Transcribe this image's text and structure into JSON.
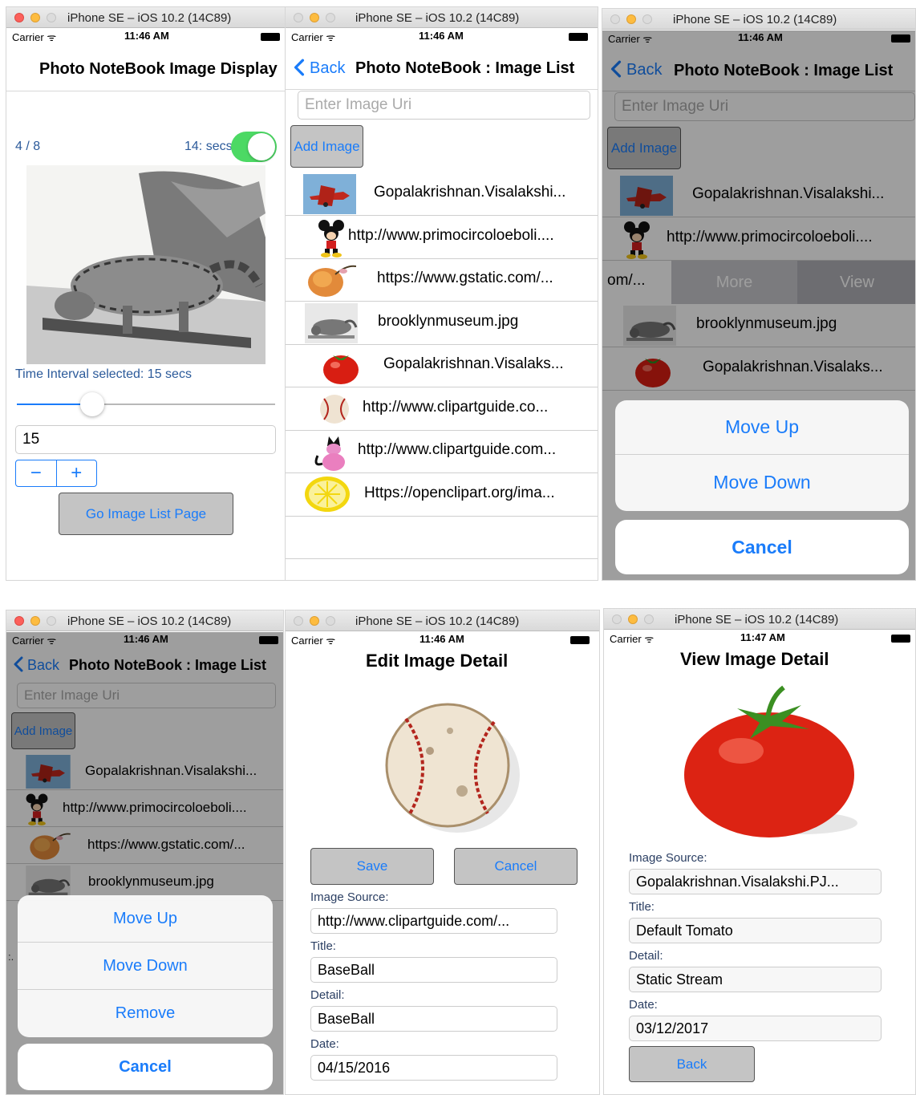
{
  "window_title": "iPhone SE – iOS 10.2 (14C89)",
  "status": {
    "carrier": "Carrier",
    "time": "11:46 AM",
    "time_last": "11:47 AM"
  },
  "colors": {
    "ios_blue": "#1a7cfa",
    "switch_green": "#4cd964",
    "grey_button": "#c4c4c4"
  },
  "display": {
    "title": "Photo NoteBook Image Display",
    "counter": "4 / 8",
    "seconds_label": "14: secs",
    "switch_on": true,
    "interval_label": "Time Interval selected: 15 secs",
    "slider_value": 0.27,
    "interval_value": "15",
    "stepper_minus": "−",
    "stepper_plus": "+",
    "go_button": "Go Image List Page"
  },
  "list": {
    "back": "Back",
    "title": "Photo NoteBook : Image List",
    "uri_placeholder": "Enter Image Uri",
    "add_button": "Add Image",
    "items": [
      "Gopalakrishnan.Visalakshi...",
      "http://www.primocircoloeboli....",
      "https://www.gstatic.com/...",
      "brooklynmuseum.jpg",
      "Gopalakrishnan.Visalaks...",
      "http://www.clipartguide.co...",
      "http://www.clipartguide.com...",
      "Https://openclipart.org/ima..."
    ]
  },
  "swipe": {
    "partial": "om/...",
    "more": "More",
    "view": "View"
  },
  "sheet_a": {
    "move_up": "Move Up",
    "move_down": "Move Down",
    "cancel": "Cancel"
  },
  "sheet_b": {
    "move_up": "Move Up",
    "move_down": "Move Down",
    "remove": "Remove",
    "cancel": "Cancel",
    "edge_text": ":."
  },
  "edit": {
    "title": "Edit Image Detail",
    "save": "Save",
    "cancel": "Cancel",
    "source_label": "Image Source:",
    "source": "http://www.clipartguide.com/...",
    "title_label": "Title:",
    "title_value": "BaseBall",
    "detail_label": "Detail:",
    "detail_value": "BaseBall",
    "date_label": "Date:",
    "date_value": "04/15/2016"
  },
  "view": {
    "title": "View Image Detail",
    "source_label": "Image Source:",
    "source": "Gopalakrishnan.Visalakshi.PJ...",
    "title_label": "Title:",
    "title_value": "Default Tomato",
    "detail_label": "Detail:",
    "detail_value": "Static Stream",
    "date_label": "Date:",
    "date_value": "03/12/2017",
    "back": "Back"
  },
  "thumb_icons": [
    "airplane-icon",
    "mickey-icon",
    "rose-icon",
    "ocelot-icon",
    "tomato-icon",
    "baseball-icon",
    "cat-icon",
    "lemon-icon"
  ]
}
